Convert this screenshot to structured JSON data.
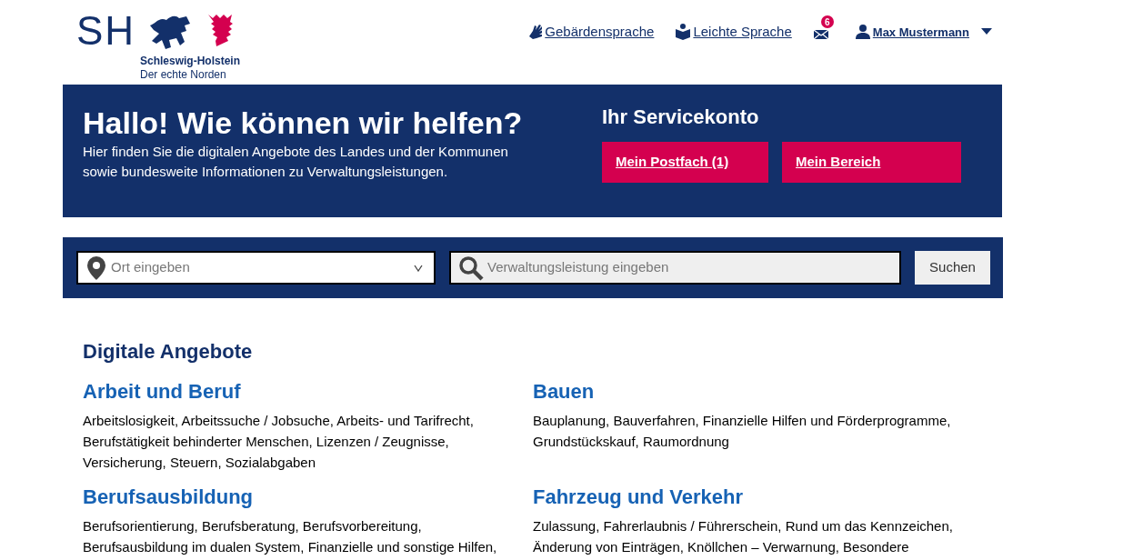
{
  "logo": {
    "letters": "SH",
    "name": "Schleswig-Holstein",
    "slogan": "Der echte Norden"
  },
  "top_links": [
    {
      "kind": "sign",
      "label": "Gebärdensprache"
    },
    {
      "kind": "easy",
      "label": "Leichte Sprache"
    },
    {
      "kind": "mail",
      "badge": "6"
    },
    {
      "kind": "user",
      "label": "Max Mustermann"
    }
  ],
  "hero": {
    "title": "Hallo! Wie können wir helfen?",
    "text": "Hier finden Sie die digitalen Angebote des Landes und der Kommunen sowie bundesweite Informationen zu Verwaltungsleistungen.",
    "account_title": "Ihr Servicekonto",
    "buttons": [
      "Mein Postfach (1)",
      "Mein Bereich"
    ]
  },
  "search": {
    "location_placeholder": "Ort eingeben",
    "service_placeholder": "Verwaltungsleistung eingeben",
    "button": "Suchen"
  },
  "section_title": "Digitale Angebote",
  "categories": [
    {
      "title": "Arbeit und Beruf",
      "text": "Arbeitslosigkeit, Arbeitssuche / Jobsuche, Arbeits- und Tarifrecht, Berufstätigkeit behinderter Menschen, Lizenzen / Zeugnisse, Versicherung, Steuern, Sozialabgaben"
    },
    {
      "title": "Bauen",
      "text": "Bauplanung, Bauverfahren, Finanzielle Hilfen und Förderprogramme, Grundstückskauf, Raumordnung"
    },
    {
      "title": "Berufsausbildung",
      "text": "Berufsorientierung, Berufsberatung, Berufsvorbereitung, Berufsausbildung im dualen System, Finanzielle und sonstige Hilfen,"
    },
    {
      "title": "Fahrzeug und Verkehr",
      "text": "Zulassung, Fahrerlaubnis / Führerschein, Rund um das Kennzeichen, Änderung von Einträgen, Knöllchen – Verwarnung, Besondere"
    }
  ]
}
